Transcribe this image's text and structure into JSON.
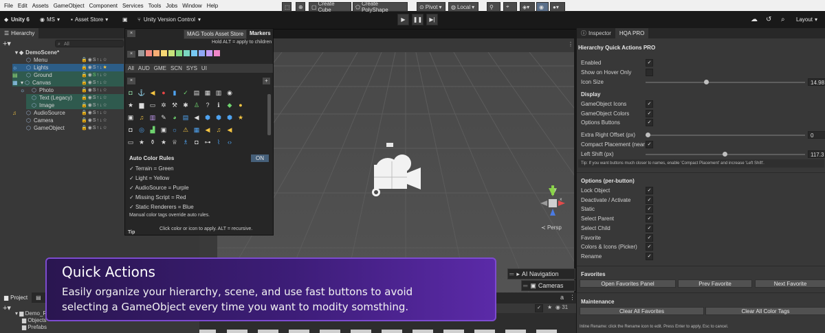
{
  "menu": [
    "File",
    "Edit",
    "Assets",
    "GameObject",
    "Component",
    "Services",
    "Tools",
    "Jobs",
    "Window",
    "Help"
  ],
  "toolbar": {
    "unity_version": "Unity 6",
    "account": "MS",
    "asset_store": "Asset Store",
    "version_control": "Unity Version Control",
    "layout": "Layout"
  },
  "hierarchy": {
    "tab": "Hierarchy",
    "search_placeholder": "All",
    "scene": "DemoScene*",
    "items": [
      {
        "name": "Menu",
        "indent": 1
      },
      {
        "name": "Lights",
        "indent": 1
      },
      {
        "name": "Ground",
        "indent": 1
      },
      {
        "name": "Canvas",
        "indent": 1
      },
      {
        "name": "Photo",
        "indent": 2
      },
      {
        "name": "Text (Legacy)",
        "indent": 2
      },
      {
        "name": "Image",
        "indent": 2
      },
      {
        "name": "AudioSource",
        "indent": 1
      },
      {
        "name": "Camera",
        "indent": 1
      },
      {
        "name": "GameObject",
        "indent": 1
      }
    ]
  },
  "popup": {
    "tab_store": "MAG Tools Asset Store",
    "tab_markers": "Markers",
    "hint": "Hold ALT = apply to children",
    "swatch_colors": [
      "#9a9a9a",
      "#f28b82",
      "#f6ad74",
      "#f7d774",
      "#c7e27a",
      "#81d684",
      "#7ad6c0",
      "#77c8f2",
      "#8fa7f5",
      "#c39af2",
      "#ef86c9"
    ],
    "categories": [
      "All",
      "AUD",
      "GME",
      "SCN",
      "SYS",
      "UI"
    ],
    "auto_title": "Auto Color Rules",
    "auto_toggle": "ON",
    "rules": [
      "Terrain = Green",
      "Light = Yellow",
      "AudioSource = Purple",
      "Missing Script = Red",
      "Static Renderers = Blue"
    ],
    "override_note": "Manual color tags override auto rules.",
    "apply_note": "Click color or icon to apply. ALT = recursive.",
    "tip": "Tip"
  },
  "scene_toolbar": {
    "create_cube": "Create Cube",
    "create_polyshape": "Create PolyShape",
    "pivot": "Pivot",
    "local": "Local"
  },
  "scene": {
    "persp": "Persp",
    "ai_navigation": "AI Navigation",
    "cameras": "Cameras",
    "count": "31"
  },
  "project": {
    "tab": "Project",
    "folders": [
      "Demo_R",
      "Objects",
      "Prefabs"
    ]
  },
  "banner": {
    "title": "Quick Actions",
    "line1": "Easily organize your hierarchy, scene, and use fast buttons to avoid",
    "line2": "selecting a GameObject every time you want to modity somsthing."
  },
  "inspector": {
    "tab_inspector": "Inspector",
    "tab_hqa": "HQA PRO",
    "title": "Hierarchy Quick Actions PRO",
    "enabled": "Enabled",
    "show_on_hover": "Show on Hover Only",
    "icon_size": "Icon Size",
    "icon_size_value": "14.98",
    "display_head": "Display",
    "go_icons": "GameObject Icons",
    "go_colors": "GameObject Colors",
    "options_buttons": "Options Buttons",
    "extra_right": "Extra Right Offset (px)",
    "extra_right_value": "0",
    "compact": "Compact Placement (near",
    "left_shift": "Left Shift (px)",
    "left_shift_value": "117.3",
    "tip": "Tip: If you want buttons much closer to names, enable 'Compact Placement' and increase 'Left Shift'.",
    "options_head": "Options (per-button)",
    "options": [
      "Lock Object",
      "Deactivate / Activate",
      "Static",
      "Select Parent",
      "Select Child",
      "Favorite",
      "Colors & Icons (Picker)",
      "Rename"
    ],
    "favorites_head": "Favorites",
    "open_favorites": "Open Favorites Panel",
    "prev_favorite": "Prev Favorite",
    "next_favorite": "Next Favorite",
    "maintenance_head": "Maintenance",
    "clear_favorites": "Clear All Favorites",
    "clear_colors": "Clear All Color Tags",
    "footer": "Inline Rename: click the Rename icon to edit. Press Enter to apply, Esc to cancel."
  },
  "colors": {
    "banner_border": "#7d4bd0",
    "selected_row": "#2c5d87",
    "canvas_row": "#2f5a4e"
  }
}
